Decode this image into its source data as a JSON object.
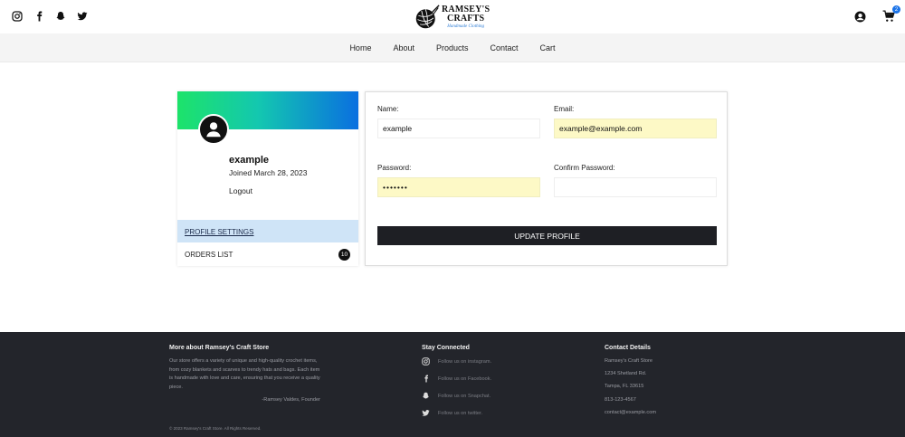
{
  "header": {
    "logo_title_line1": "RAMSEY'S",
    "logo_title_line2": "CRAFTS",
    "logo_subtitle": "Handmade Clothing",
    "cart_count": "2",
    "social_icons": [
      "instagram-icon",
      "facebook-icon",
      "snapchat-icon",
      "twitter-icon"
    ]
  },
  "nav": {
    "items": [
      {
        "label": "Home"
      },
      {
        "label": "About"
      },
      {
        "label": "Products"
      },
      {
        "label": "Contact"
      },
      {
        "label": "Cart"
      }
    ]
  },
  "profile": {
    "name": "example",
    "joined": "Joined March 28, 2023",
    "logout": "Logout",
    "menu_settings": "PROFILE SETTINGS",
    "menu_orders": "ORDERS LIST",
    "orders_count": "10"
  },
  "form": {
    "name_label": "Name:",
    "name_value": "example",
    "email_label": "Email:",
    "email_value": "example@example.com",
    "password_label": "Password:",
    "password_value": "example",
    "confirm_label": "Confirm Password:",
    "confirm_value": "",
    "update_button": "UPDATE PROFILE"
  },
  "footer": {
    "about_title": "More about Ramsey's Craft Store",
    "about_text": "Our store offers a variety of unique and high-quality crochet items, from cozy blankets and scarves to trendy hats and bags. Each item is handmade with love and care, ensuring that you receive a quality piece.",
    "about_sign": "-Ramsey Valdes, Founder",
    "copyright": "© 2023 Ramsey's Craft Store. All Rights Reserved.",
    "social_title": "Stay Connected",
    "social_links": [
      {
        "icon": "instagram-icon",
        "label": "Follow us on instagram."
      },
      {
        "icon": "facebook-icon",
        "label": "Follow us on Facebook."
      },
      {
        "icon": "snapchat-icon",
        "label": "Follow us on Snapchat."
      },
      {
        "icon": "twitter-icon",
        "label": "Follow us on twitter."
      }
    ],
    "contact_title": "Contact Details",
    "contact_lines": [
      "Ramsey's Craft Store",
      "1234 Shetland Rd.",
      "Tampa, FL 33615",
      "813-123-4567",
      "contact@example.com"
    ]
  },
  "colors": {
    "accent_blue": "#1a73e8",
    "nav_bg": "#f4f4f4",
    "footer_bg": "#23252b",
    "button_bg": "#1e1f24",
    "autofill_bg": "#fdf9c6",
    "active_menu_bg": "#cfe4f7"
  }
}
